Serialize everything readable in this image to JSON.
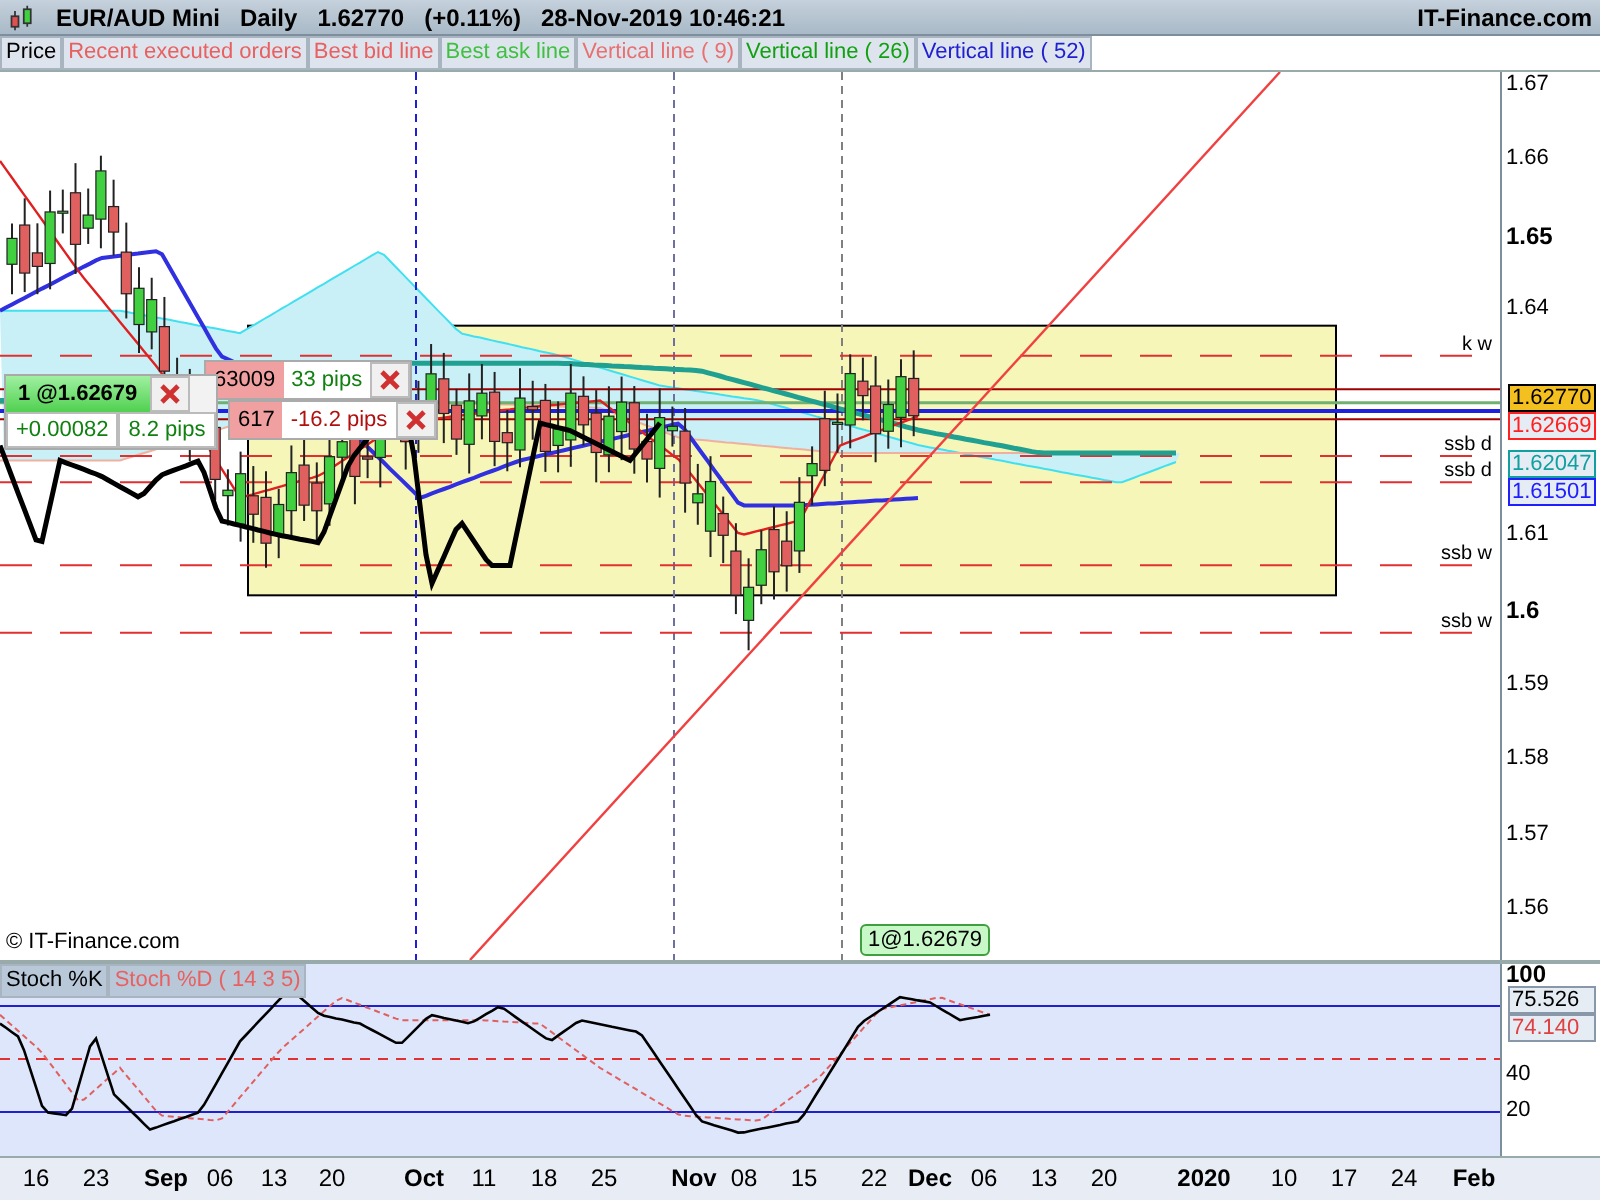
{
  "header": {
    "symbol": "EUR/AUD Mini",
    "period": "Daily",
    "price": "1.62770",
    "change": "(+0.11%)",
    "datetime": "28-Nov-2019 10:46:21",
    "brand": "IT-Finance.com"
  },
  "legend": [
    {
      "label": "Price",
      "color": "#000000"
    },
    {
      "label": "Recent executed orders",
      "color": "#e86060"
    },
    {
      "label": "Best bid line",
      "color": "#e86060"
    },
    {
      "label": "Best ask line",
      "color": "#40c040"
    },
    {
      "label": "Vertical line ( 9)",
      "color": "#e87070"
    },
    {
      "label": "Vertical line ( 26)",
      "color": "#10a010"
    },
    {
      "label": "Vertical line ( 52)",
      "color": "#2020d0"
    }
  ],
  "price_axis": {
    "ticks": [
      {
        "label": "1.67",
        "major": false
      },
      {
        "label": "1.66",
        "major": false
      },
      {
        "label": "1.65",
        "major": true
      },
      {
        "label": "1.64",
        "major": false
      },
      {
        "label": "1.61",
        "major": false
      },
      {
        "label": "1.6",
        "major": true
      },
      {
        "label": "1.59",
        "major": false
      },
      {
        "label": "1.58",
        "major": false
      },
      {
        "label": "1.57",
        "major": false
      },
      {
        "label": "1.56",
        "major": false
      }
    ],
    "tags": [
      {
        "value": "1.62770",
        "color": "#000000",
        "selected": true
      },
      {
        "value": "1.62669",
        "color": "#ff2020",
        "selected": false
      },
      {
        "value": "1.62047",
        "color": "#10a0a0",
        "selected": false
      },
      {
        "value": "1.61501",
        "color": "#2020ff",
        "selected": false
      }
    ]
  },
  "level_labels": [
    "k w",
    "ssb d",
    "ssb d",
    "ssb w",
    "ssb w"
  ],
  "position": {
    "label": "1 @1.62679",
    "profit": "+0.00082",
    "pips": "8.2 pips"
  },
  "hidden_positions": [
    {
      "price": "63009",
      "pips": "33 pips",
      "positive": true
    },
    {
      "price": "617",
      "pips": "-16.2 pips",
      "positive": false
    }
  ],
  "copyright": "© IT-Finance.com",
  "order_tag": "1@1.62679",
  "stoch": {
    "legend": [
      {
        "label": "Stoch %K",
        "color": "#000000"
      },
      {
        "label": "Stoch %D ( 14 3 5)",
        "color": "#e86060"
      }
    ],
    "ticks": [
      {
        "label": "100",
        "major": true
      },
      {
        "label": "40",
        "major": false
      },
      {
        "label": "20",
        "major": false
      }
    ],
    "tags": [
      {
        "value": "75.526",
        "color": "#000000"
      },
      {
        "value": "74.140",
        "color": "#e04040"
      }
    ]
  },
  "x_axis": [
    {
      "label": "16",
      "kind": "day"
    },
    {
      "label": "23",
      "kind": "day"
    },
    {
      "label": "Sep",
      "kind": "month"
    },
    {
      "label": "06",
      "kind": "day"
    },
    {
      "label": "13",
      "kind": "day"
    },
    {
      "label": "20",
      "kind": "day"
    },
    {
      "label": "Oct",
      "kind": "month"
    },
    {
      "label": "11",
      "kind": "day"
    },
    {
      "label": "18",
      "kind": "day"
    },
    {
      "label": "25",
      "kind": "day"
    },
    {
      "label": "Nov",
      "kind": "month"
    },
    {
      "label": "08",
      "kind": "day"
    },
    {
      "label": "15",
      "kind": "day"
    },
    {
      "label": "22",
      "kind": "day"
    },
    {
      "label": "Dec",
      "kind": "month"
    },
    {
      "label": "06",
      "kind": "day"
    },
    {
      "label": "13",
      "kind": "day"
    },
    {
      "label": "20",
      "kind": "day"
    },
    {
      "label": "2020",
      "kind": "month"
    },
    {
      "label": "10",
      "kind": "day"
    },
    {
      "label": "17",
      "kind": "day"
    },
    {
      "label": "24",
      "kind": "day"
    },
    {
      "label": "Feb",
      "kind": "month"
    }
  ]
}
